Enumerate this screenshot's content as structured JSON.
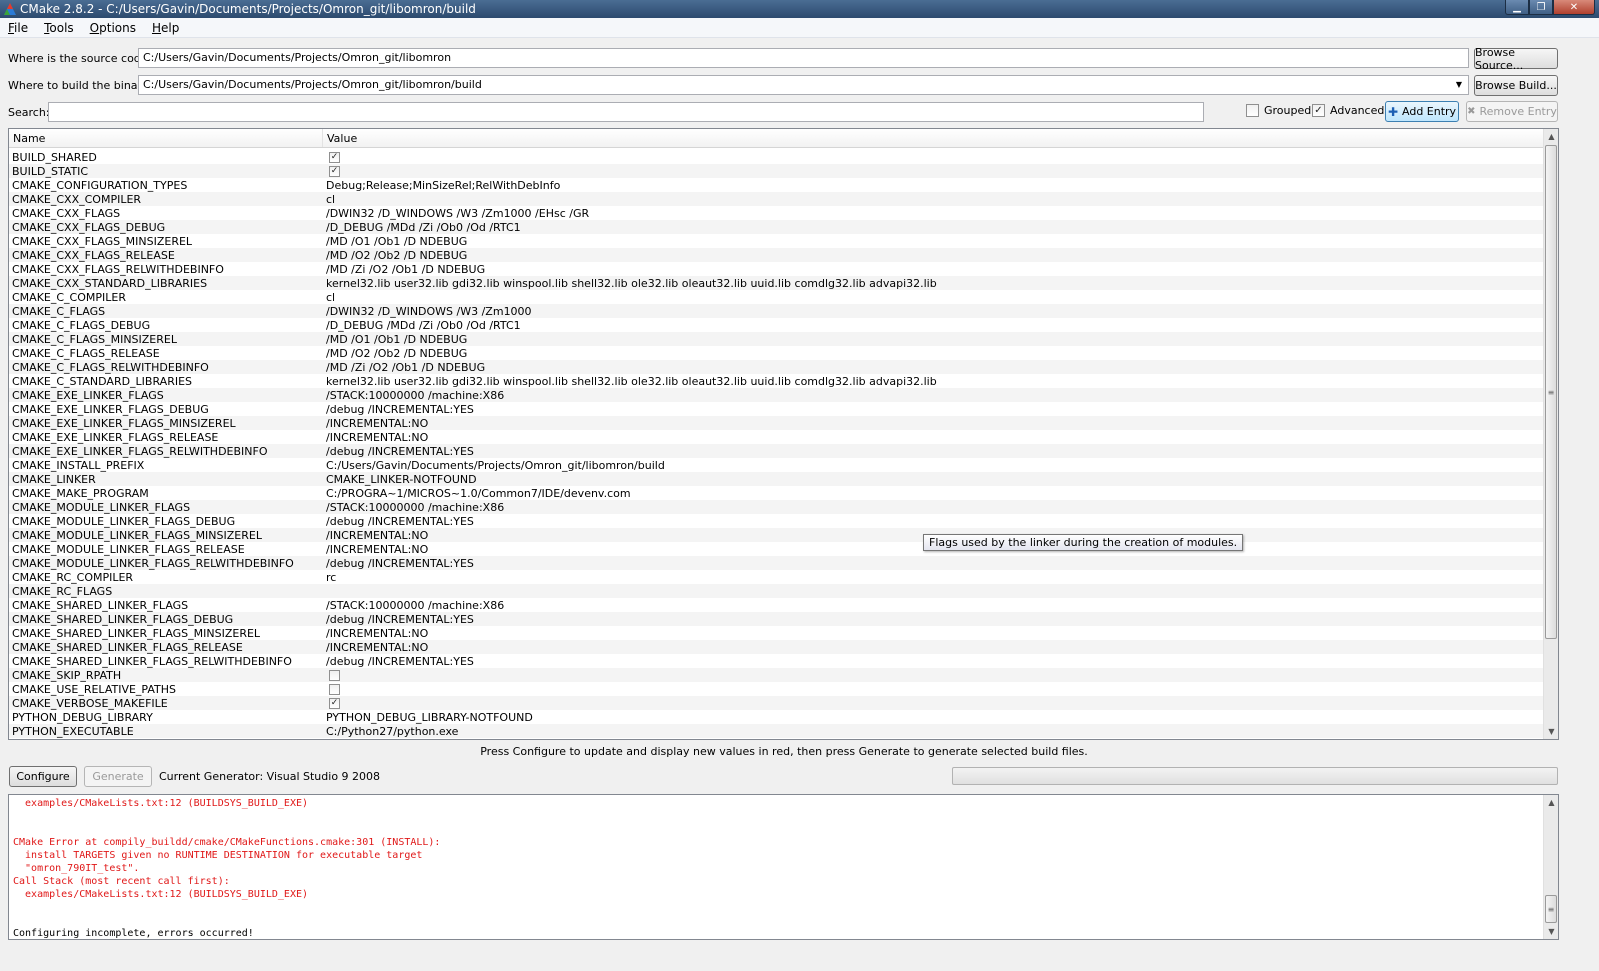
{
  "window": {
    "title": "CMake 2.8.2 - C:/Users/Gavin/Documents/Projects/Omron_git/libomron/build",
    "controls": {
      "minimize": "▁",
      "maximize": "❐",
      "close": "✕"
    }
  },
  "menu": [
    {
      "u": "F",
      "rest": "ile"
    },
    {
      "u": "T",
      "rest": "ools"
    },
    {
      "u": "O",
      "rest": "ptions"
    },
    {
      "u": "H",
      "rest": "elp"
    }
  ],
  "source": {
    "label": "Where is the source code:",
    "value": "C:/Users/Gavin/Documents/Projects/Omron_git/libomron",
    "browse_label": "Browse Source..."
  },
  "build": {
    "label": "Where to build the binaries:",
    "value": "C:/Users/Gavin/Documents/Projects/Omron_git/libomron/build",
    "browse_label": "Browse Build..."
  },
  "search": {
    "label": "Search:",
    "value": ""
  },
  "options": {
    "grouped_label": "Grouped",
    "grouped_checked": false,
    "advanced_label": "Advanced",
    "advanced_checked": true
  },
  "buttons": {
    "add_entry": "Add Entry",
    "remove_entry": "Remove Entry",
    "configure": "Configure",
    "generate": "Generate"
  },
  "table": {
    "columns": {
      "name": "Name",
      "value": "Value"
    },
    "rows": [
      {
        "name": "BUILD_SHARED",
        "type": "bool",
        "checked": true
      },
      {
        "name": "BUILD_STATIC",
        "type": "bool",
        "checked": true
      },
      {
        "name": "CMAKE_CONFIGURATION_TYPES",
        "value": "Debug;Release;MinSizeRel;RelWithDebInfo"
      },
      {
        "name": "CMAKE_CXX_COMPILER",
        "value": "cl"
      },
      {
        "name": "CMAKE_CXX_FLAGS",
        "value": " /DWIN32 /D_WINDOWS /W3 /Zm1000 /EHsc /GR"
      },
      {
        "name": "CMAKE_CXX_FLAGS_DEBUG",
        "value": "/D_DEBUG /MDd /Zi /Ob0 /Od /RTC1"
      },
      {
        "name": "CMAKE_CXX_FLAGS_MINSIZEREL",
        "value": "/MD /O1 /Ob1 /D NDEBUG"
      },
      {
        "name": "CMAKE_CXX_FLAGS_RELEASE",
        "value": "/MD /O2 /Ob2 /D NDEBUG"
      },
      {
        "name": "CMAKE_CXX_FLAGS_RELWITHDEBINFO",
        "value": "/MD /Zi /O2 /Ob1 /D NDEBUG"
      },
      {
        "name": "CMAKE_CXX_STANDARD_LIBRARIES",
        "value": "kernel32.lib user32.lib gdi32.lib winspool.lib shell32.lib ole32.lib oleaut32.lib uuid.lib comdlg32.lib advapi32.lib"
      },
      {
        "name": "CMAKE_C_COMPILER",
        "value": "cl"
      },
      {
        "name": "CMAKE_C_FLAGS",
        "value": " /DWIN32 /D_WINDOWS /W3 /Zm1000"
      },
      {
        "name": "CMAKE_C_FLAGS_DEBUG",
        "value": "/D_DEBUG /MDd /Zi  /Ob0 /Od /RTC1"
      },
      {
        "name": "CMAKE_C_FLAGS_MINSIZEREL",
        "value": "/MD /O1 /Ob1 /D NDEBUG"
      },
      {
        "name": "CMAKE_C_FLAGS_RELEASE",
        "value": "/MD /O2 /Ob2 /D NDEBUG"
      },
      {
        "name": "CMAKE_C_FLAGS_RELWITHDEBINFO",
        "value": "/MD /Zi /O2 /Ob1 /D NDEBUG"
      },
      {
        "name": "CMAKE_C_STANDARD_LIBRARIES",
        "value": "kernel32.lib user32.lib gdi32.lib winspool.lib shell32.lib ole32.lib oleaut32.lib uuid.lib comdlg32.lib advapi32.lib"
      },
      {
        "name": "CMAKE_EXE_LINKER_FLAGS",
        "value": " /STACK:10000000 /machine:X86"
      },
      {
        "name": "CMAKE_EXE_LINKER_FLAGS_DEBUG",
        "value": "/debug /INCREMENTAL:YES"
      },
      {
        "name": "CMAKE_EXE_LINKER_FLAGS_MINSIZEREL",
        "value": "/INCREMENTAL:NO"
      },
      {
        "name": "CMAKE_EXE_LINKER_FLAGS_RELEASE",
        "value": "/INCREMENTAL:NO"
      },
      {
        "name": "CMAKE_EXE_LINKER_FLAGS_RELWITHDEBINFO",
        "value": "/debug /INCREMENTAL:YES"
      },
      {
        "name": "CMAKE_INSTALL_PREFIX",
        "value": "C:/Users/Gavin/Documents/Projects/Omron_git/libomron/build"
      },
      {
        "name": "CMAKE_LINKER",
        "value": "CMAKE_LINKER-NOTFOUND"
      },
      {
        "name": "CMAKE_MAKE_PROGRAM",
        "value": "C:/PROGRA~1/MICROS~1.0/Common7/IDE/devenv.com"
      },
      {
        "name": "CMAKE_MODULE_LINKER_FLAGS",
        "value": " /STACK:10000000 /machine:X86"
      },
      {
        "name": "CMAKE_MODULE_LINKER_FLAGS_DEBUG",
        "value": "/debug /INCREMENTAL:YES"
      },
      {
        "name": "CMAKE_MODULE_LINKER_FLAGS_MINSIZEREL",
        "value": "/INCREMENTAL:NO"
      },
      {
        "name": "CMAKE_MODULE_LINKER_FLAGS_RELEASE",
        "value": "/INCREMENTAL:NO"
      },
      {
        "name": "CMAKE_MODULE_LINKER_FLAGS_RELWITHDEBINFO",
        "value": "/debug /INCREMENTAL:YES"
      },
      {
        "name": "CMAKE_RC_COMPILER",
        "value": "rc"
      },
      {
        "name": "CMAKE_RC_FLAGS",
        "value": ""
      },
      {
        "name": "CMAKE_SHARED_LINKER_FLAGS",
        "value": " /STACK:10000000 /machine:X86"
      },
      {
        "name": "CMAKE_SHARED_LINKER_FLAGS_DEBUG",
        "value": "/debug /INCREMENTAL:YES"
      },
      {
        "name": "CMAKE_SHARED_LINKER_FLAGS_MINSIZEREL",
        "value": "/INCREMENTAL:NO"
      },
      {
        "name": "CMAKE_SHARED_LINKER_FLAGS_RELEASE",
        "value": "/INCREMENTAL:NO"
      },
      {
        "name": "CMAKE_SHARED_LINKER_FLAGS_RELWITHDEBINFO",
        "value": "/debug /INCREMENTAL:YES"
      },
      {
        "name": "CMAKE_SKIP_RPATH",
        "type": "bool",
        "checked": false
      },
      {
        "name": "CMAKE_USE_RELATIVE_PATHS",
        "type": "bool",
        "checked": false
      },
      {
        "name": "CMAKE_VERBOSE_MAKEFILE",
        "type": "bool",
        "checked": true
      },
      {
        "name": "PYTHON_DEBUG_LIBRARY",
        "value": "PYTHON_DEBUG_LIBRARY-NOTFOUND"
      },
      {
        "name": "PYTHON_EXECUTABLE",
        "value": "C:/Python27/python.exe"
      }
    ]
  },
  "tooltip": "Flags used by the linker during the creation of modules.",
  "hint": "Press Configure to update and display new values in red, then press Generate to generate selected build files.",
  "generator": "Current Generator: Visual Studio 9 2008",
  "log": [
    {
      "text": "  examples/CMakeLists.txt:12 (BUILDSYS_BUILD_EXE)",
      "error": true
    },
    {
      "text": "",
      "error": false
    },
    {
      "text": "",
      "error": false
    },
    {
      "text": "CMake Error at compily_buildd/cmake/CMakeFunctions.cmake:301 (INSTALL):",
      "error": true
    },
    {
      "text": "  install TARGETS given no RUNTIME DESTINATION for executable target",
      "error": true
    },
    {
      "text": "  \"omron_790IT_test\".",
      "error": true
    },
    {
      "text": "Call Stack (most recent call first):",
      "error": true
    },
    {
      "text": "  examples/CMakeLists.txt:12 (BUILDSYS_BUILD_EXE)",
      "error": true
    },
    {
      "text": "",
      "error": false
    },
    {
      "text": "",
      "error": false
    },
    {
      "text": "Configuring incomplete, errors occurred!",
      "error": false
    }
  ],
  "icons": {
    "checkmark": "✓",
    "up_arrow": "▲",
    "down_arrow": "▼",
    "grip": "≡",
    "combo_arrow": "▼",
    "add": "✚",
    "remove": "✖"
  }
}
